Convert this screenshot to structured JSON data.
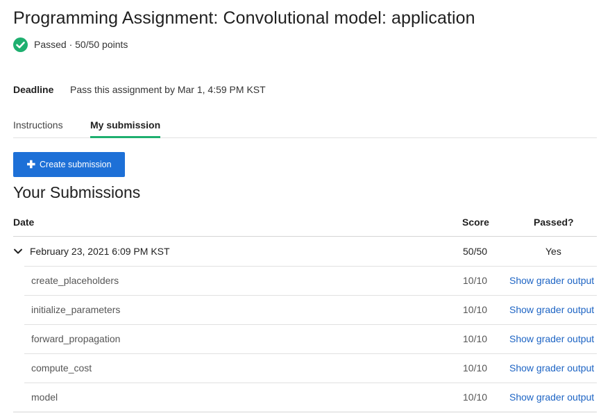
{
  "header": {
    "title": "Programming Assignment: Convolutional model: application",
    "status": "Passed · 50/50 points",
    "status_color": "#1eaf6f"
  },
  "deadline": {
    "label": "Deadline",
    "text": "Pass this assignment by Mar 1, 4:59 PM KST"
  },
  "tabs": [
    {
      "label": "Instructions",
      "active": false
    },
    {
      "label": "My submission",
      "active": true
    }
  ],
  "create_button": {
    "label": "Create submission",
    "icon": "plus-icon"
  },
  "submissions": {
    "title": "Your Submissions",
    "columns": {
      "date": "Date",
      "score": "Score",
      "passed": "Passed?"
    },
    "entry": {
      "date": "February 23, 2021 6:09 PM KST",
      "score": "50/50",
      "passed": "Yes",
      "expanded": true
    },
    "parts": [
      {
        "name": "create_placeholders",
        "score": "10/10",
        "link": "Show grader output"
      },
      {
        "name": "initialize_parameters",
        "score": "10/10",
        "link": "Show grader output"
      },
      {
        "name": "forward_propagation",
        "score": "10/10",
        "link": "Show grader output"
      },
      {
        "name": "compute_cost",
        "score": "10/10",
        "link": "Show grader output"
      },
      {
        "name": "model",
        "score": "10/10",
        "link": "Show grader output"
      }
    ]
  },
  "colors": {
    "accent": "#1d70d7",
    "link": "#1d64c4",
    "success": "#1eaf6f"
  }
}
